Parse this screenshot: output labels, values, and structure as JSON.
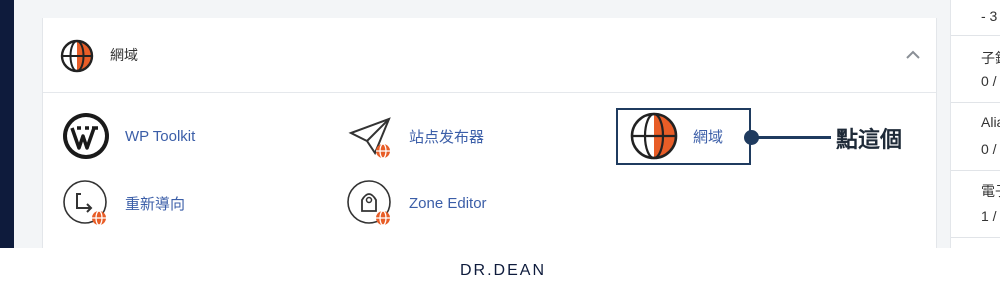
{
  "panel": {
    "title": "網域",
    "items": [
      {
        "label": "WP Toolkit",
        "icon": "wordpress-icon"
      },
      {
        "label": "站点发布器",
        "icon": "paper-plane-icon"
      },
      {
        "label": "網域",
        "icon": "globe-icon"
      },
      {
        "label": "重新導向",
        "icon": "redirect-icon"
      },
      {
        "label": "Zone Editor",
        "icon": "rocket-icon"
      }
    ]
  },
  "callout": {
    "text": "點這個"
  },
  "right_column": {
    "rows": [
      {
        "label": "- 3"
      },
      {
        "label": "子鎖"
      },
      {
        "value": "0 /"
      },
      {
        "label": "Alia"
      },
      {
        "value": "0 /"
      },
      {
        "label": "電子"
      },
      {
        "value": "1 /"
      }
    ]
  },
  "brand": {
    "text": "DR.DEAN"
  },
  "colors": {
    "accent": "#e85d27",
    "link": "#3b5ea8",
    "navy": "#0e1b3c",
    "callout": "#1f3b5f"
  }
}
